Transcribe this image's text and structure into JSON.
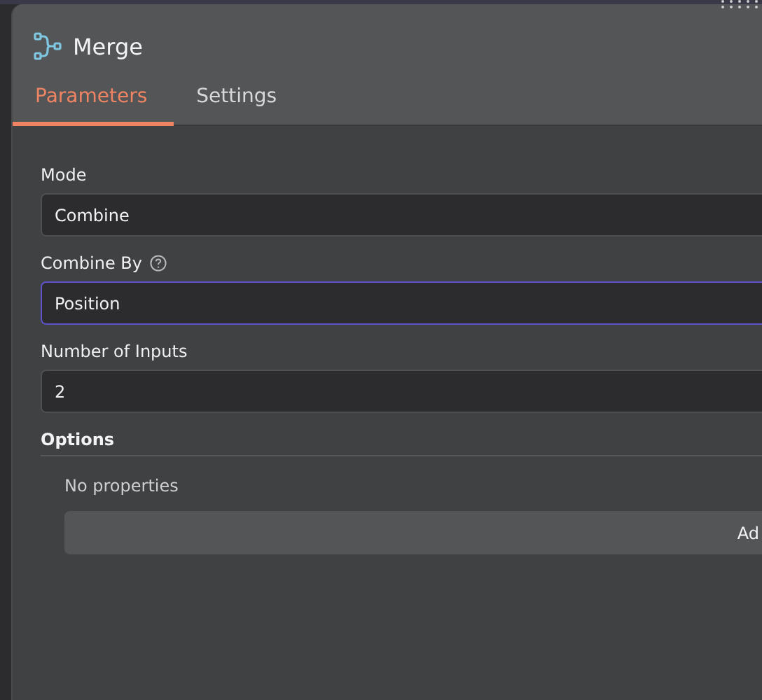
{
  "node": {
    "title": "Merge"
  },
  "tabs": [
    {
      "label": "Parameters",
      "selected": true
    },
    {
      "label": "Settings",
      "selected": false
    }
  ],
  "fields": [
    {
      "label": "Mode",
      "value": "Combine",
      "help": false,
      "focused": false
    },
    {
      "label": "Combine By",
      "value": "Position",
      "help": true,
      "focused": true
    },
    {
      "label": "Number of Inputs",
      "value": "2",
      "help": false,
      "focused": false
    }
  ],
  "options": {
    "title": "Options",
    "empty_text": "No properties",
    "button": "Ad"
  }
}
